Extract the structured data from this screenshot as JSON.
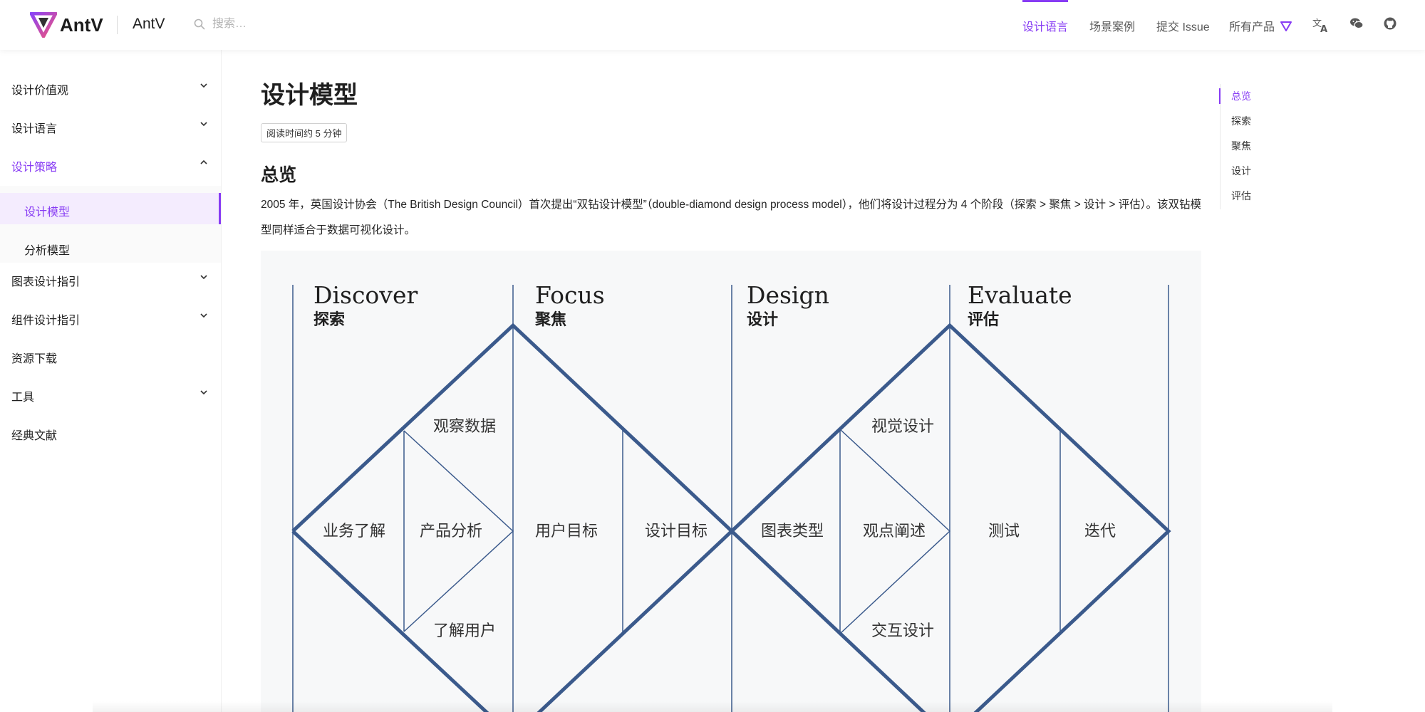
{
  "header": {
    "logo_text": "AntV",
    "subbrand": "AntV",
    "search_placeholder": "搜索…",
    "nav": [
      {
        "label": "设计语言"
      },
      {
        "label": "场景案例"
      },
      {
        "label": "提交 Issue"
      },
      {
        "label": "所有产品"
      }
    ],
    "icons": [
      "translate-icon",
      "wechat-icon",
      "github-icon"
    ]
  },
  "sidebar": {
    "items": [
      {
        "label": "设计价值观"
      },
      {
        "label": "设计语言"
      },
      {
        "label": "设计策略"
      },
      {
        "label": "图表设计指引"
      },
      {
        "label": "组件设计指引"
      },
      {
        "label": "资源下载"
      },
      {
        "label": "工具"
      },
      {
        "label": "经典文献"
      }
    ],
    "subitems": [
      {
        "label": "设计模型"
      },
      {
        "label": "分析模型"
      }
    ]
  },
  "main": {
    "title": "设计模型",
    "read_time": "阅读时间约 5 分钟",
    "section_title": "总览",
    "paragraph": "2005 年，英国设计协会（The British Design Council）首次提出“双钻设计模型”（double-diamond design process model），他们将设计过程分为 4 个阶段（探索 > 聚焦 > 设计 > 评估）。该双钻模型同样适合于数据可视化设计。"
  },
  "diagram": {
    "phases": [
      {
        "en": "Discover",
        "zh": "探索"
      },
      {
        "en": "Focus",
        "zh": "聚焦"
      },
      {
        "en": "Design",
        "zh": "设计"
      },
      {
        "en": "Evaluate",
        "zh": "评估"
      }
    ],
    "labels": {
      "observe_data": "观察数据",
      "business": "业务了解",
      "product": "产品分析",
      "understand_users": "了解用户",
      "user_goals": "用户目标",
      "design_goals": "设计目标",
      "visual_design": "视觉设计",
      "chart_type": "图表类型",
      "viewpoint": "观点阐述",
      "interaction": "交互设计",
      "testing": "测试",
      "iteration": "迭代"
    },
    "line_color": "#3b5a8c"
  },
  "toc": {
    "items": [
      {
        "label": "总览"
      },
      {
        "label": "探索"
      },
      {
        "label": "聚焦"
      },
      {
        "label": "设计"
      },
      {
        "label": "评估"
      }
    ]
  },
  "colors": {
    "accent": "#873bf4",
    "diagram_line": "#3b5a8c",
    "figure_bg": "#f7f8f9"
  }
}
